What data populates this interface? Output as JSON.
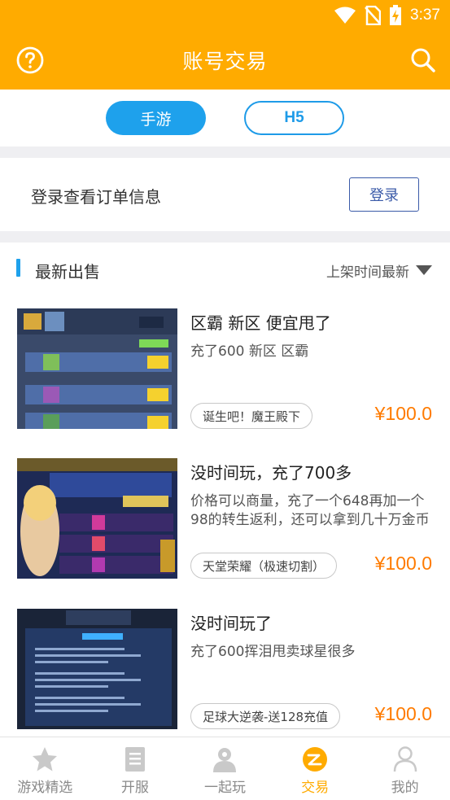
{
  "status_bar": {
    "time": "3:37"
  },
  "header": {
    "title": "账号交易"
  },
  "tabs": [
    {
      "label": "手游",
      "active": true
    },
    {
      "label": "H5",
      "active": false
    }
  ],
  "login": {
    "prompt": "登录查看订单信息",
    "button": "登录"
  },
  "section": {
    "title": "最新出售",
    "sort_label": "上架时间最新"
  },
  "listings": [
    {
      "title": "区霸 新区  便宜甩了",
      "desc": "充了600  新区  区霸",
      "game": "诞生吧！魔王殿下",
      "price": "¥100.0"
    },
    {
      "title": "没时间玩，充了700多",
      "desc": "价格可以商量，充了一个648再加一个98的转生返利，还可以拿到几十万金币",
      "game": "天堂荣耀（极速切割）",
      "price": "¥100.0"
    },
    {
      "title": "没时间玩了",
      "desc": "充了600挥泪甩卖球星很多",
      "game": "足球大逆袭-送128充值",
      "price": "¥100.0"
    }
  ],
  "nav": [
    {
      "label": "游戏精选",
      "icon": "star-icon",
      "active": false
    },
    {
      "label": "开服",
      "icon": "document-icon",
      "active": false
    },
    {
      "label": "一起玩",
      "icon": "people-icon",
      "active": false
    },
    {
      "label": "交易",
      "icon": "trade-icon",
      "active": true
    },
    {
      "label": "我的",
      "icon": "person-icon",
      "active": false
    }
  ],
  "colors": {
    "accent_orange": "#ffab00",
    "accent_blue": "#1ea1ec",
    "price": "#ff7b00"
  }
}
